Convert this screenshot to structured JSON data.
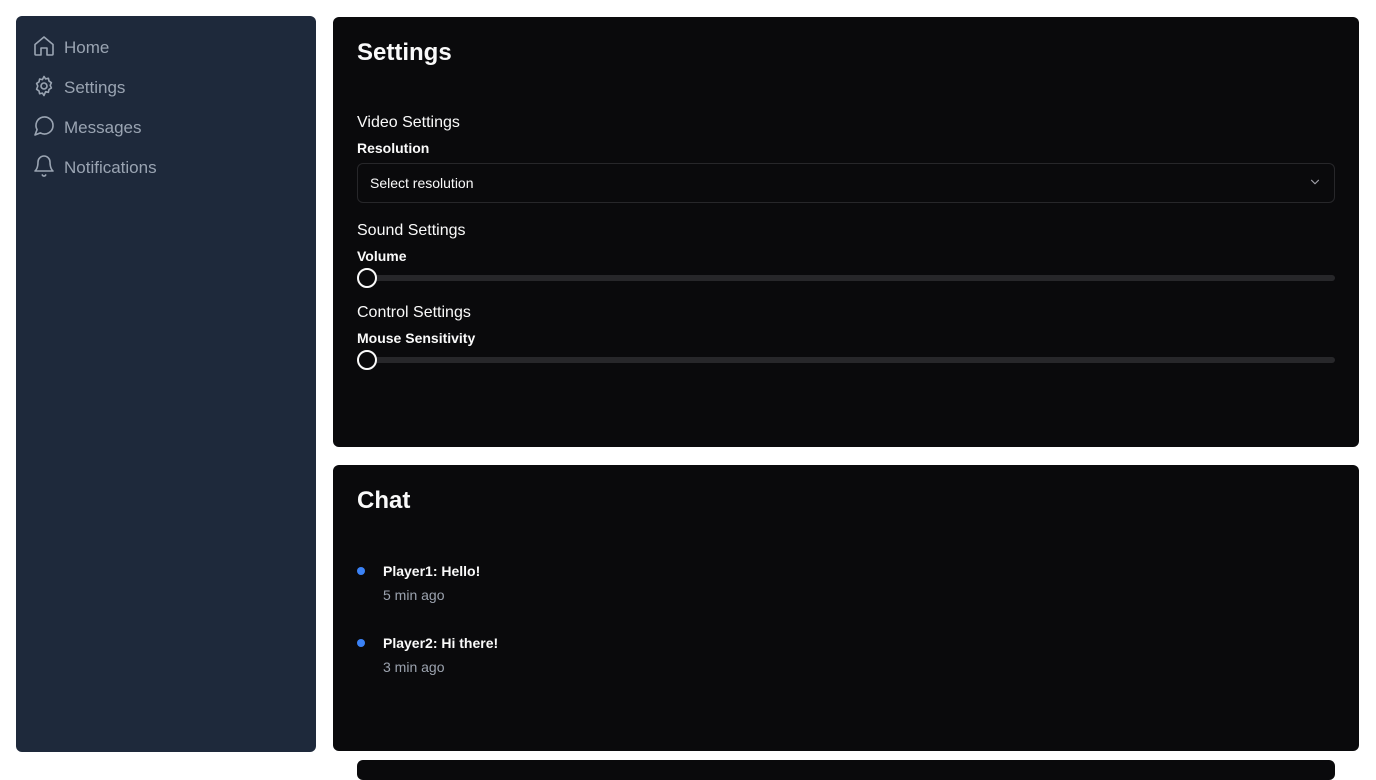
{
  "sidebar": {
    "items": [
      {
        "label": "Home",
        "icon": "home-icon"
      },
      {
        "label": "Settings",
        "icon": "gear-icon"
      },
      {
        "label": "Messages",
        "icon": "message-icon"
      },
      {
        "label": "Notifications",
        "icon": "bell-icon"
      }
    ]
  },
  "settings": {
    "title": "Settings",
    "video": {
      "title": "Video Settings",
      "resolution_label": "Resolution",
      "resolution_value": "Select resolution"
    },
    "sound": {
      "title": "Sound Settings",
      "volume_label": "Volume",
      "volume_level": 0
    },
    "control": {
      "title": "Control Settings",
      "mouse_label": "Mouse Sensitivity",
      "mouse_level": 0
    }
  },
  "chat": {
    "title": "Chat",
    "messages": [
      {
        "text": "Player1: Hello!",
        "time": "5 min ago"
      },
      {
        "text": "Player2: Hi there!",
        "time": "3 min ago"
      }
    ]
  },
  "colors": {
    "sidebar_bg": "#1e293b",
    "card_bg": "#0a0a0c",
    "accent_dot": "#3b82f6"
  }
}
